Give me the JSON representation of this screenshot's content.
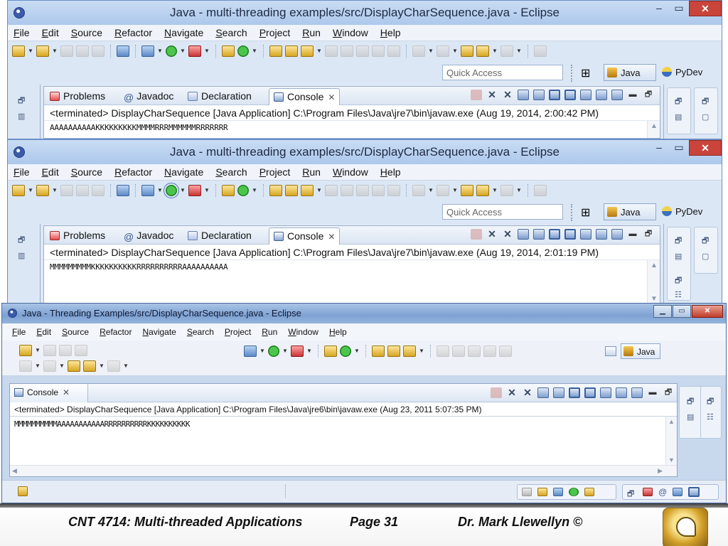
{
  "windows": [
    {
      "title": "Java - multi-threading examples/src/DisplayCharSequence.java - Eclipse",
      "menu": [
        "File",
        "Edit",
        "Source",
        "Refactor",
        "Navigate",
        "Search",
        "Project",
        "Run",
        "Window",
        "Help"
      ],
      "quick_access_placeholder": "Quick Access",
      "perspectives": [
        "Java",
        "PyDev"
      ],
      "tabs": [
        "Problems",
        "Javadoc",
        "Declaration",
        "Console"
      ],
      "status": "<terminated> DisplayCharSequence [Java Application] C:\\Program Files\\Java\\jre7\\bin\\javaw.exe (Aug 19, 2014, 2:00:42 PM)",
      "output": "AAAAAAAAAAKKKKKKKKKMMMMRRRMMMMMMRRRRRRR"
    },
    {
      "title": "Java - multi-threading examples/src/DisplayCharSequence.java - Eclipse",
      "menu": [
        "File",
        "Edit",
        "Source",
        "Refactor",
        "Navigate",
        "Search",
        "Project",
        "Run",
        "Window",
        "Help"
      ],
      "quick_access_placeholder": "Quick Access",
      "perspectives": [
        "Java",
        "PyDev"
      ],
      "tabs": [
        "Problems",
        "Javadoc",
        "Declaration",
        "Console"
      ],
      "status": "<terminated> DisplayCharSequence [Java Application] C:\\Program Files\\Java\\jre7\\bin\\javaw.exe (Aug 19, 2014, 2:01:19 PM)",
      "output": "MMMMMMMMMKKKKKKKKKKRRRRRRRRRRAAAAAAAAAA"
    },
    {
      "title": "Java - Threading Examples/src/DisplayCharSequence.java - Eclipse",
      "menu": [
        "File",
        "Edit",
        "Source",
        "Refactor",
        "Navigate",
        "Search",
        "Project",
        "Run",
        "Window",
        "Help"
      ],
      "perspectives": [
        "Java"
      ],
      "tabs": [
        "Console"
      ],
      "status": "<terminated> DisplayCharSequence [Java Application] C:\\Program Files\\Java\\jre6\\bin\\javaw.exe (Aug 23, 2011 5:07:35 PM)",
      "output": "MMMMMMMMMMAAAAAAAAAAARRRRRRRRRRKKKKKKKKKK"
    }
  ],
  "footer": {
    "course": "CNT 4714: Multi-threaded Applications",
    "page": "Page 31",
    "author": "Dr. Mark Llewellyn ©"
  },
  "icons": {
    "app": "eclipse-icon",
    "close": "close-icon",
    "logo": "ucf-pegasus-logo"
  },
  "colors": {
    "title_bar": "#adc8ec",
    "close_button": "#c9443a",
    "panel_border": "#9bb0cc"
  }
}
